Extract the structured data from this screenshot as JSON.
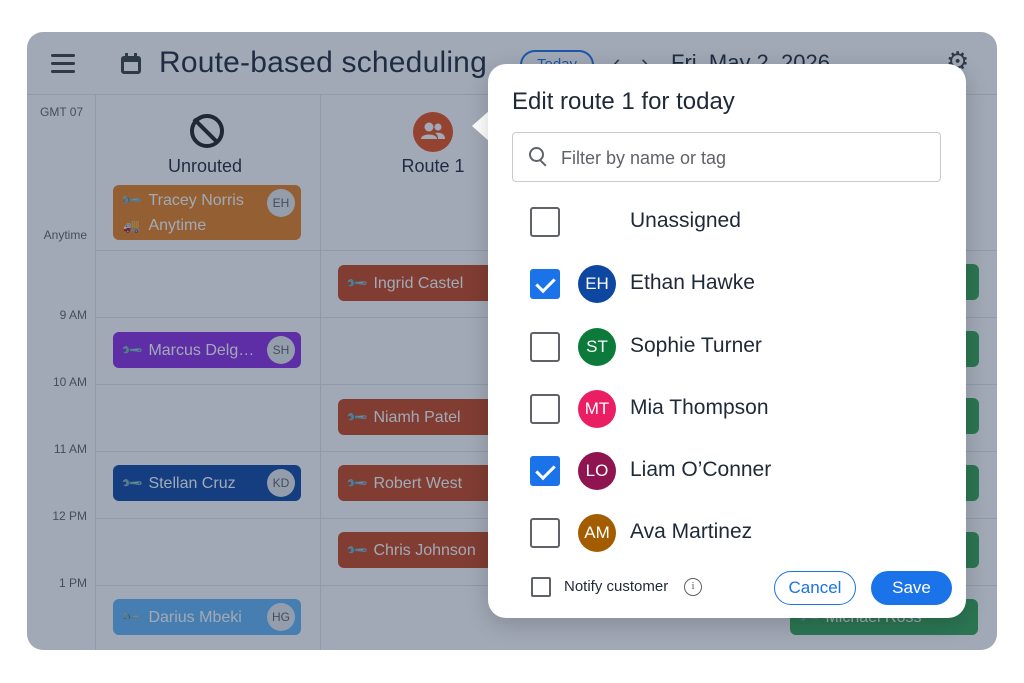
{
  "header": {
    "title": "Route-based scheduling",
    "today_label": "Today",
    "prev_arrow": "‹",
    "next_arrow": "›",
    "date": "Fri, May 2, 2026",
    "menu_icon": "hamburger-menu-icon",
    "calendar_icon": "calendar-icon",
    "settings_icon": "gear-icon"
  },
  "grid": {
    "timezone": "GMT 07",
    "anytime_label": "Anytime",
    "times": [
      "9 AM",
      "10 AM",
      "11 AM",
      "12 PM",
      "1 PM"
    ]
  },
  "columns": {
    "unrouted": {
      "label": "Unrouted",
      "icon": "no-route-icon"
    },
    "route1": {
      "label": "Route 1",
      "icon": "people-icon"
    }
  },
  "appointments": {
    "tracey": {
      "name": "Tracey Norris",
      "sub": "Anytime",
      "badge": "EH",
      "color": "#e8821e"
    },
    "marcus": {
      "name": "Marcus Delg…",
      "badge": "SH",
      "color": "#8a2be2"
    },
    "stellan": {
      "name": "Stellan Cruz",
      "badge": "KD",
      "color": "#0d47a1"
    },
    "darius": {
      "name": "Darius Mbeki",
      "badge": "HG",
      "color": "#64b5f6"
    },
    "ingrid": {
      "name": "Ingrid Castel",
      "color": "#c9451c"
    },
    "niamh": {
      "name": "Niamh Patel",
      "color": "#c9451c"
    },
    "robert": {
      "name": "Robert West",
      "color": "#c9451c"
    },
    "chris": {
      "name": "Chris Johnson",
      "color": "#c9451c"
    },
    "michael": {
      "name": "Michael Ross",
      "color": "#34a853"
    }
  },
  "dialog": {
    "title": "Edit route 1 for today",
    "search_placeholder": "Filter by name or tag",
    "options": [
      {
        "label": "Unassigned",
        "checked": false
      },
      {
        "label": "Ethan Hawke",
        "initials": "EH",
        "avatar_color": "#0d47a1",
        "checked": true
      },
      {
        "label": "Sophie Turner",
        "initials": "ST",
        "avatar_color": "#0b7a3b",
        "checked": false
      },
      {
        "label": "Mia Thompson",
        "initials": "MT",
        "avatar_color": "#e91e63",
        "checked": false
      },
      {
        "label": "Liam O’Conner",
        "initials": "LO",
        "avatar_color": "#8e1550",
        "checked": true
      },
      {
        "label": "Ava Martinez",
        "initials": "AM",
        "avatar_color": "#a35c00",
        "checked": false
      }
    ],
    "notify_label": "Notify customer",
    "info_icon": "i",
    "cancel_label": "Cancel",
    "save_label": "Save"
  }
}
